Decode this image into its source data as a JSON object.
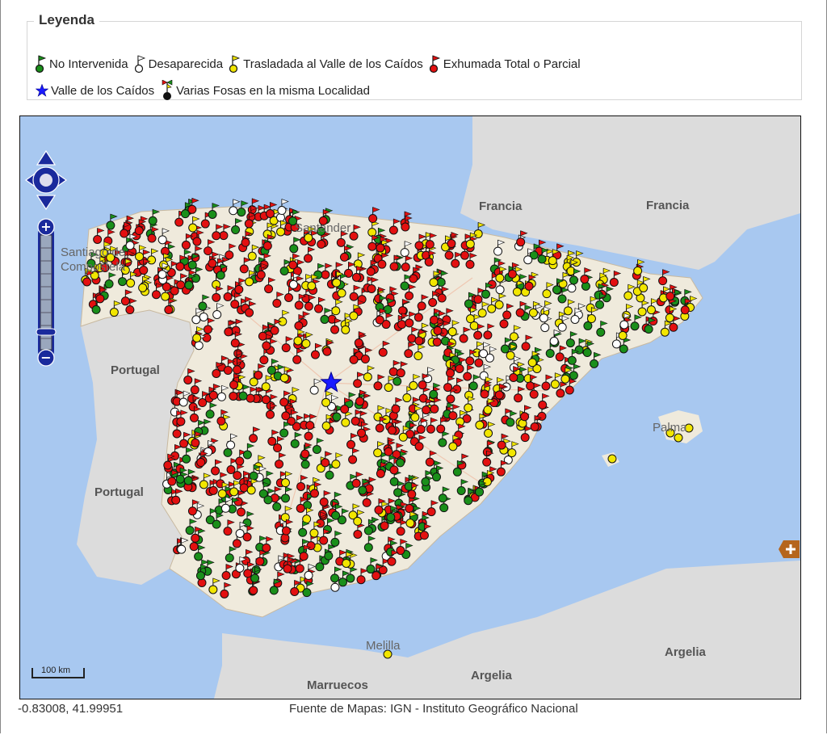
{
  "legend": {
    "title": "Leyenda",
    "items": [
      {
        "label": "No Intervenida",
        "color": "#1a8f1a",
        "icon": "green-flag-pin"
      },
      {
        "label": "Desaparecida",
        "color": "#ffffff",
        "icon": "white-flag-pin"
      },
      {
        "label": "Trasladada al Valle de los Caídos",
        "color": "#f2e600",
        "icon": "yellow-flag-pin"
      },
      {
        "label": "Exhumada Total o Parcial",
        "color": "#e31010",
        "icon": "red-flag-pin"
      },
      {
        "label": "Valle de los Caídos",
        "color": "#1a1aff",
        "icon": "blue-star"
      },
      {
        "label": "Varias Fosas en la misma Localidad",
        "color": "#111111",
        "icon": "black-multi-pin"
      }
    ]
  },
  "map": {
    "labels": {
      "santiago": "Santiago de Compostela",
      "santander": "Santander",
      "francia_1": "Francia",
      "francia_2": "Francia",
      "portugal_1": "Portugal",
      "portugal_2": "Portugal",
      "palma": "Palma",
      "melilla": "Melilla",
      "argelia_1": "Argelia",
      "argelia_2": "Argelia",
      "marruecos": "Marruecos"
    },
    "scale_label": "100 km",
    "controls": {
      "pan": "pan-control",
      "zoom_in": "+",
      "zoom_out": "−"
    },
    "colors": {
      "sea": "#a8c8f0",
      "spain_land": "#efeadc",
      "foreign_land": "#dcdcdc",
      "pin_outline": "#111111"
    }
  },
  "footer": {
    "coordinates": "-0.83008, 41.99951",
    "source": "Fuente de Mapas: IGN - Instituto Geográfico Nacional"
  }
}
